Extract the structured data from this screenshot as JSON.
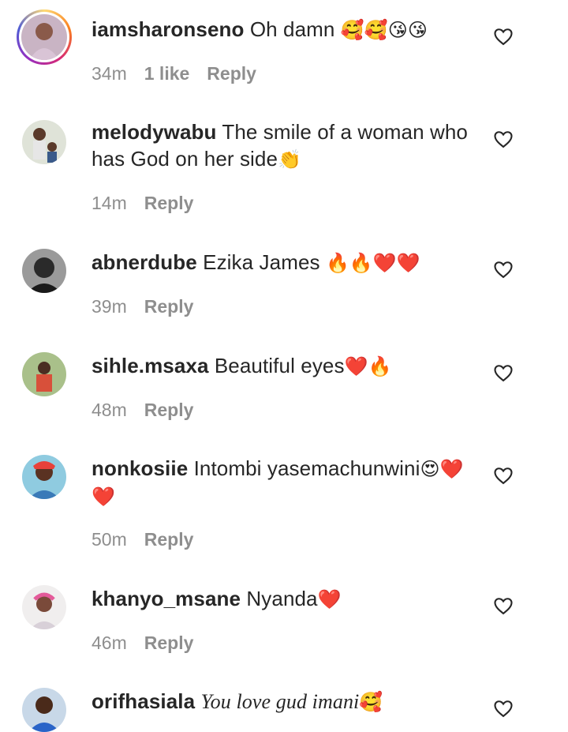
{
  "comments": [
    {
      "username": "iamsharonseno",
      "text": "Oh damn ",
      "emojis": "🥰🥰😘😘",
      "time": "34m",
      "likes": "1 like",
      "reply": "Reply",
      "avatar_color": "#b58ab0"
    },
    {
      "username": "melodywabu",
      "text": "The smile of a woman who has God on her side",
      "emojis": "👏",
      "time": "14m",
      "reply": "Reply",
      "avatar_color": "#7a8a6a"
    },
    {
      "username": "abnerdube",
      "text": "Ezika James ",
      "emojis": "🔥🔥❤️❤️",
      "time": "39m",
      "reply": "Reply",
      "avatar_color": "#3d3d3d"
    },
    {
      "username": "sihle.msaxa",
      "text": "Beautiful eyes",
      "emojis": "❤️🔥",
      "time": "48m",
      "reply": "Reply",
      "avatar_color": "#6b8a4a"
    },
    {
      "username": "nonkosiie",
      "text": "Intombi yasemachunwini",
      "emojis": "😍❤️❤️",
      "time": "50m",
      "reply": "Reply",
      "avatar_color": "#4aa3c8"
    },
    {
      "username": "khanyo_msane",
      "text": "Nyanda",
      "emojis": "❤️",
      "time": "46m",
      "reply": "Reply",
      "avatar_color": "#d8a0b0"
    },
    {
      "username": "orifhasiala",
      "text": "You love gud imani",
      "emojis": "🥰",
      "time": "",
      "reply": "",
      "avatar_color": "#2a64c8"
    }
  ],
  "colors": {
    "text": "#262626",
    "meta": "#8e8e8e",
    "heart_outline": "#262626"
  }
}
